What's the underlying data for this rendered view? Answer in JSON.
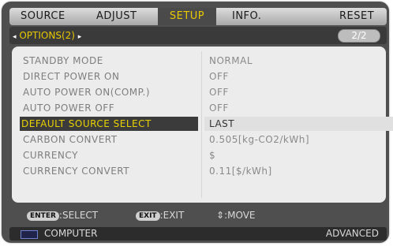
{
  "menu": {
    "tabs": [
      {
        "label": "SOURCE"
      },
      {
        "label": "ADJUST"
      },
      {
        "label": "SETUP",
        "active": true
      },
      {
        "label": "INFO."
      },
      {
        "label": "RESET"
      }
    ]
  },
  "submenu": {
    "label": "OPTIONS(2)",
    "left_arrow": "◂",
    "right_arrow": "▸",
    "page": "2/2"
  },
  "settings": [
    {
      "label": "STANDBY MODE",
      "value": "NORMAL"
    },
    {
      "label": "DIRECT POWER ON",
      "value": "OFF"
    },
    {
      "label": "AUTO POWER ON(COMP.)",
      "value": "OFF"
    },
    {
      "label": "AUTO POWER OFF",
      "value": "OFF"
    },
    {
      "label": "DEFAULT SOURCE SELECT",
      "value": "LAST",
      "selected": true
    },
    {
      "label": "CARBON CONVERT",
      "value": "0.505[kg-CO2/kWh]"
    },
    {
      "label": "CURRENCY",
      "value": "$"
    },
    {
      "label": "CURRENCY CONVERT",
      "value": "0.11[$/kWh]"
    }
  ],
  "help": {
    "enter_key": "ENTER",
    "select": ":SELECT",
    "exit_key": "EXIT",
    "exit": ":EXIT",
    "move_icon": "⇕",
    "move": ":MOVE"
  },
  "footer": {
    "source": "COMPUTER",
    "mode": "ADVANCED"
  },
  "colors": {
    "accent_yellow": "#e8c900",
    "frame": "#4f4f4f",
    "panel": "#ececec"
  }
}
